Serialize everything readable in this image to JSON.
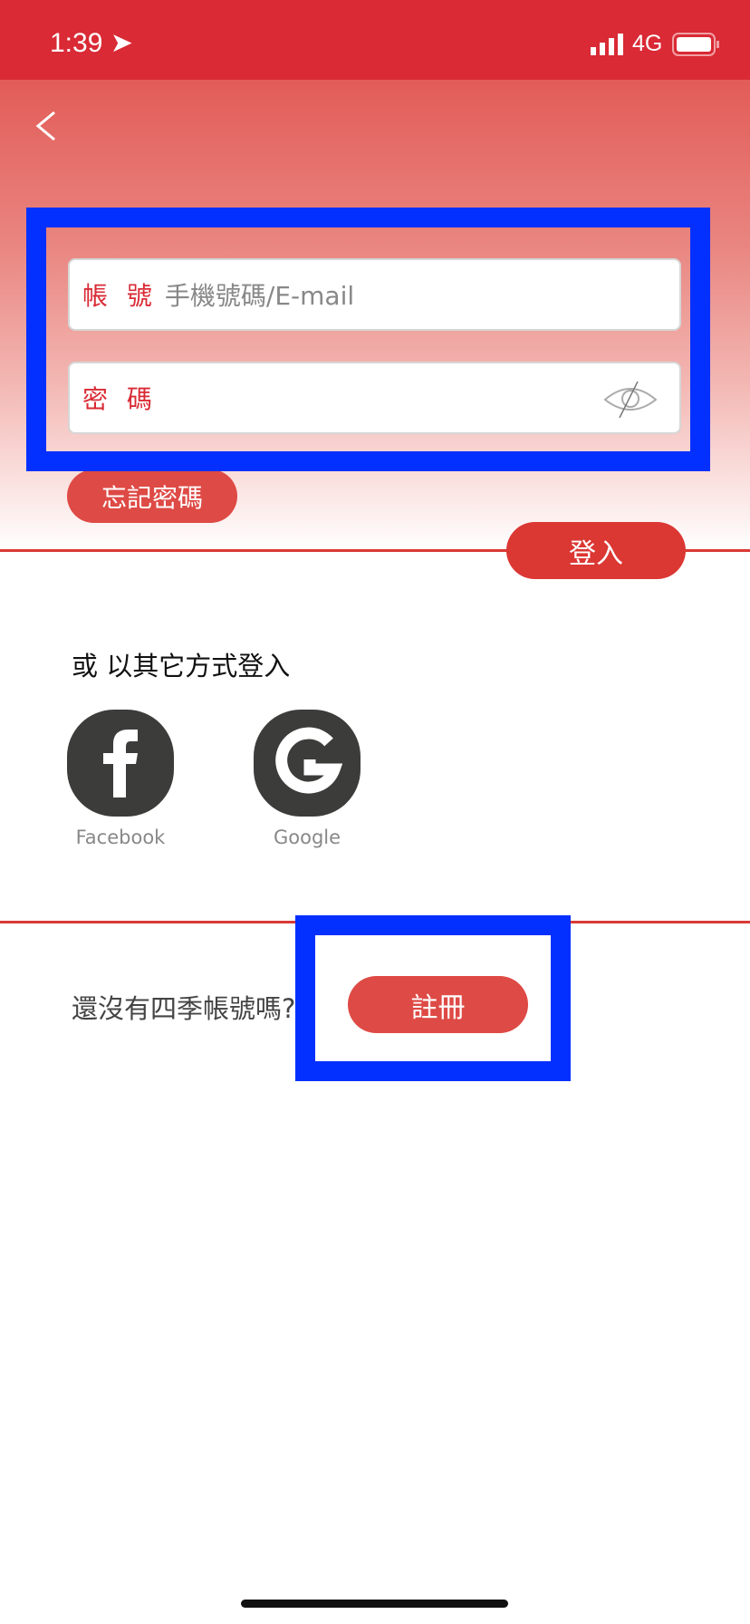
{
  "status_bar": {
    "time": "1:39",
    "network": "4G"
  },
  "login_form": {
    "account_label": "帳 號",
    "account_placeholder": "手機號碼/E-mail",
    "password_label": "密 碼",
    "forgot_password": "忘記密碼",
    "login": "登入"
  },
  "social": {
    "heading": "或 以其它方式登入",
    "providers": [
      {
        "label": "Facebook"
      },
      {
        "label": "Google"
      }
    ]
  },
  "register": {
    "prompt": "還沒有四季帳號嗎?",
    "button": "註冊"
  },
  "colors": {
    "brand": "#d92a35",
    "button": "#de4a45",
    "highlight": "#0330ff"
  }
}
